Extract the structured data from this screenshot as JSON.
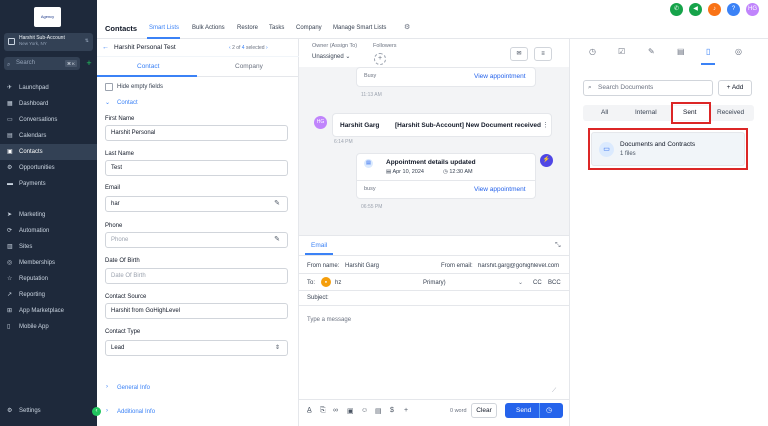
{
  "brand": {
    "logo_text": "Agency"
  },
  "account": {
    "name": "Harshit Sub-Account",
    "location": "New York, NY"
  },
  "sidebar": {
    "search_placeholder": "Search",
    "search_shortcut": "⌘ K",
    "items": [
      {
        "label": "Launchpad",
        "icon": "rocket-icon"
      },
      {
        "label": "Dashboard",
        "icon": "dashboard-icon"
      },
      {
        "label": "Conversations",
        "icon": "chat-icon"
      },
      {
        "label": "Calendars",
        "icon": "calendar-icon"
      },
      {
        "label": "Contacts",
        "icon": "contacts-icon"
      },
      {
        "label": "Opportunities",
        "icon": "funnel-icon"
      },
      {
        "label": "Payments",
        "icon": "card-icon"
      },
      {
        "label": "Marketing",
        "icon": "send-icon"
      },
      {
        "label": "Automation",
        "icon": "automation-icon"
      },
      {
        "label": "Sites",
        "icon": "globe-icon"
      },
      {
        "label": "Memberships",
        "icon": "membership-icon"
      },
      {
        "label": "Reputation",
        "icon": "star-icon"
      },
      {
        "label": "Reporting",
        "icon": "chart-icon"
      },
      {
        "label": "App Marketplace",
        "icon": "grid-icon"
      },
      {
        "label": "Mobile App",
        "icon": "phone-icon"
      }
    ],
    "settings_label": "Settings"
  },
  "topnav": {
    "title": "Contacts",
    "items": [
      "Smart Lists",
      "Bulk Actions",
      "Restore",
      "Tasks",
      "Company",
      "Manage Smart Lists"
    ],
    "user_initials": "HG"
  },
  "contact": {
    "name": "Harshit Personal Test",
    "pager_current": "2",
    "pager_of": "of",
    "pager_total": "4",
    "pager_selected": "selected",
    "tab_contact": "Contact",
    "tab_company": "Company",
    "hide_empty_label": "Hide empty fields",
    "section_contact": "Contact",
    "fields": {
      "first_name_label": "First Name",
      "first_name": "Harshit Personal",
      "last_name_label": "Last Name",
      "last_name": "Test",
      "email_label": "Email",
      "email": "har",
      "phone_label": "Phone",
      "phone_placeholder": "Phone",
      "dob_label": "Date Of Birth",
      "dob_placeholder": "Date Of Birth",
      "source_label": "Contact Source",
      "source": "Harshit from GoHighLevel",
      "type_label": "Contact Type",
      "type": "Lead"
    },
    "general_info": "General Info",
    "additional_info": "Additional Info"
  },
  "conversation": {
    "owner_label": "Owner (Assign To)",
    "followers_label": "Followers",
    "owner_value": "Unassigned",
    "msg1_status": "Busy",
    "msg1_link": "View appointment",
    "msg1_time": "11:13 AM",
    "msg2_avatar": "HG",
    "msg2_sender": "Harshit Garg",
    "msg2_subject": "[Harshit Sub-Account] New Document received",
    "msg2_time": "6:14 PM",
    "msg3_title": "Appointment details updated",
    "msg3_date": "Apr 10, 2024",
    "msg3_clock": "12:30 AM",
    "msg3_status": "busy",
    "msg3_link": "View appointment",
    "msg3_time": "06:55 PM"
  },
  "composer": {
    "tab": "Email",
    "from_name_label": "From name:",
    "from_name": "Harshit Garg",
    "from_email_label": "From email:",
    "from_email": "harshit.garg@gohighlevel.com",
    "to_label": "To:",
    "to_value": "hz",
    "to_type": "Primary)",
    "cc": "CC",
    "bcc": "BCC",
    "subject_label": "Subject:",
    "body_placeholder": "Type a message",
    "word_count": "0 word",
    "clear": "Clear",
    "send": "Send"
  },
  "documents": {
    "search_placeholder": "Search Documents",
    "add_label": "+ Add",
    "filters": [
      "All",
      "Internal",
      "Sent",
      "Received"
    ],
    "folder_name": "Documents and Contracts",
    "folder_count": "1 files"
  },
  "colors": {
    "accent": "#3b82f6",
    "sidebar_bg": "#1e293b",
    "highlight_red": "#dc2626",
    "send_blue": "#2563eb"
  }
}
